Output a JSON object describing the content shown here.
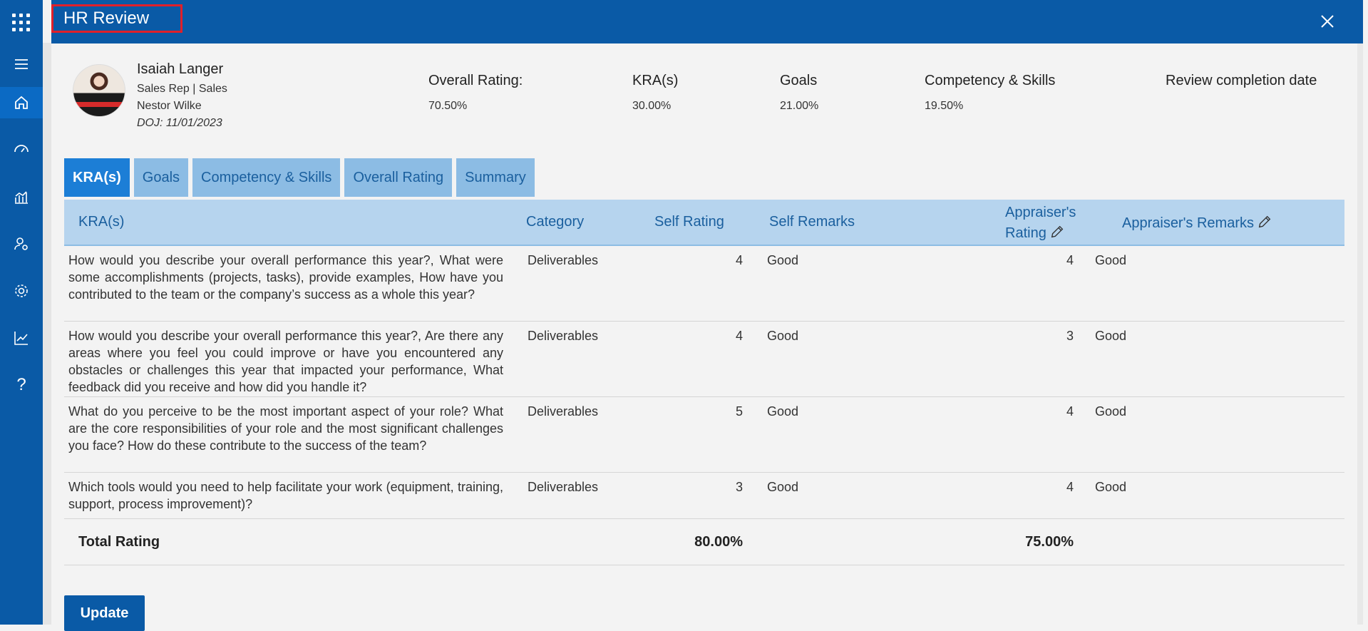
{
  "panel": {
    "title": "HR Review"
  },
  "employee": {
    "name": "Isaiah Langer",
    "role": "Sales Rep | Sales",
    "manager": "Nestor Wilke",
    "doj": "DOJ: 11/01/2023"
  },
  "metrics": [
    {
      "label": "Overall Rating:",
      "value": "70.50%"
    },
    {
      "label": "KRA(s)",
      "value": "30.00%"
    },
    {
      "label": "Goals",
      "value": "21.00%"
    },
    {
      "label": "Competency & Skills",
      "value": "19.50%"
    },
    {
      "label": "Review completion date",
      "value": ""
    }
  ],
  "tabs": [
    "KRA(s)",
    "Goals",
    "Competency & Skills",
    "Overall Rating",
    "Summary"
  ],
  "table": {
    "headers": {
      "kra": "KRA(s)",
      "category": "Category",
      "self_rating": "Self Rating",
      "self_remarks": "Self Remarks",
      "appraiser_rating_1": "Appraiser's",
      "appraiser_rating_2": "Rating",
      "appraiser_remarks": "Appraiser's Remarks"
    },
    "rows": [
      {
        "kra": "How would you describe your overall performance this year?, What were some accomplishments (projects, tasks), provide examples, How have you contributed to the team or the company’s success as a whole this year?",
        "category": "Deliverables",
        "self_rating": "4",
        "self_remarks": "Good",
        "appraiser_rating": "4",
        "appraiser_remarks": "Good"
      },
      {
        "kra": "How would you describe your overall performance this year?, Are there any areas where you feel you could improve or have you encountered any obstacles or challenges this year that impacted your performance, What feedback did you receive and how did you handle it?",
        "category": "Deliverables",
        "self_rating": "4",
        "self_remarks": "Good",
        "appraiser_rating": "3",
        "appraiser_remarks": "Good"
      },
      {
        "kra": "What do you perceive to be the most important aspect of your role? What are the core responsibilities of your role and the most significant challenges you face? How do these contribute to the success of the team?",
        "category": "Deliverables",
        "self_rating": "5",
        "self_remarks": "Good",
        "appraiser_rating": "4",
        "appraiser_remarks": "Good"
      },
      {
        "kra": "Which tools would you need to help facilitate your work (equipment, training, support, process improvement)?",
        "category": "Deliverables",
        "self_rating": "3",
        "self_remarks": "Good",
        "appraiser_rating": "4",
        "appraiser_remarks": "Good"
      }
    ],
    "total": {
      "label": "Total Rating",
      "self": "80.00%",
      "appraiser": "75.00%"
    }
  },
  "actions": {
    "update_label": "Update"
  },
  "icons": {
    "rail": [
      "waffle-icon",
      "menu-icon",
      "home-icon",
      "dashboard-icon",
      "analytics-icon",
      "user-settings-icon",
      "settings-icon",
      "trend-icon",
      "help-icon"
    ],
    "close": "close-icon",
    "edit": "pencil-icon"
  },
  "colors": {
    "header": "#0a5aa6",
    "tab_active": "#1c7ed6",
    "tab": "#8cbce4",
    "table_head": "#b6d4ee",
    "title_outline": "#e0202a"
  }
}
